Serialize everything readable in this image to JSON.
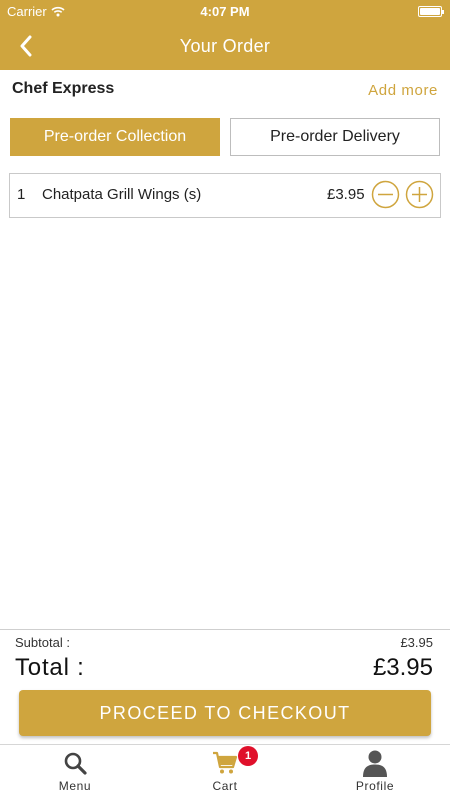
{
  "status_bar": {
    "carrier": "Carrier",
    "time": "4:07 PM"
  },
  "header": {
    "title": "Your Order"
  },
  "restaurant": {
    "name": "Chef Express",
    "add_more_label": "Add more"
  },
  "order_types": {
    "collection_label": "Pre-order Collection",
    "delivery_label": "Pre-order Delivery",
    "selected": "collection"
  },
  "items": [
    {
      "qty": "1",
      "name": "Chatpata Grill Wings (s)",
      "price": "£3.95"
    }
  ],
  "totals": {
    "subtotal_label": "Subtotal :",
    "subtotal_value": "£3.95",
    "total_label": "Total :",
    "total_value": "£3.95"
  },
  "checkout": {
    "label": "PROCEED TO CHECKOUT"
  },
  "tab_bar": {
    "menu_label": "Menu",
    "cart_label": "Cart",
    "cart_badge": "1",
    "profile_label": "Profile",
    "active_tab": "cart"
  },
  "icons": {
    "back": "chevron-left-icon",
    "minus": "minus-circle-icon",
    "plus": "plus-circle-icon",
    "menu": "search-icon",
    "cart": "cart-icon",
    "profile": "user-icon"
  },
  "colors": {
    "accent": "#cfa53e",
    "badge": "#e0102b"
  }
}
